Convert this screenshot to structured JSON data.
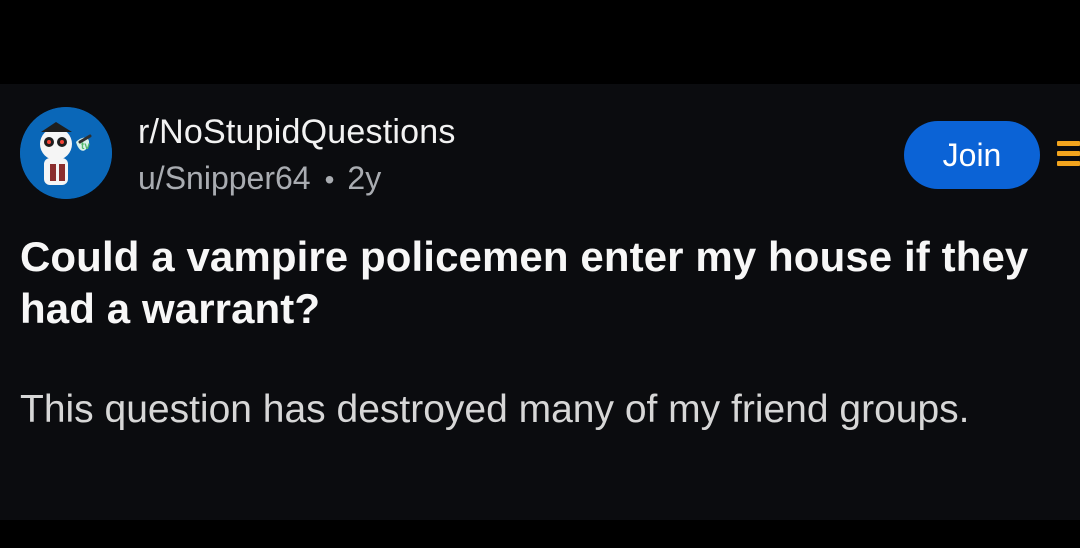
{
  "post": {
    "subreddit": "r/NoStupidQuestions",
    "author": "u/Snipper64",
    "separator": "•",
    "age": "2y",
    "join_label": "Join",
    "title": "Could a vampire policemen enter my house if they had a warrant?",
    "body": "This question has destroyed many of my friend groups."
  },
  "icons": {
    "avatar": "subreddit-avatar-icon",
    "overflow": "overflow-menu-icon"
  },
  "colors": {
    "background": "#000000",
    "card": "#0b0c0f",
    "join": "#0b63d6",
    "accent": "#f3a51e",
    "secondary_text": "#a9acb1"
  }
}
